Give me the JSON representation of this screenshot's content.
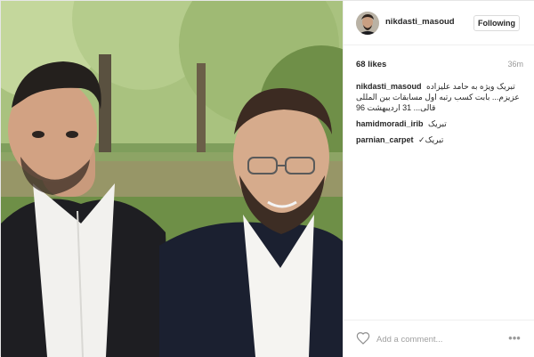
{
  "post": {
    "photo_alt": "Photo of two men",
    "header": {
      "username": "nikdasti_masoud",
      "follow_label": "Following"
    },
    "likes": "68 likes",
    "time": "36m",
    "caption": {
      "user": "nikdasti_masoud",
      "text": "تبریک ویژه به حامد علیزاده عزیزم... بابت کسب رتبه اول مسابقات بین المللی قالی... 31 اردیبهشت 96"
    },
    "comments": [
      {
        "user": "hamidmoradi_irib",
        "text": "تبریک"
      },
      {
        "user": "parnian_carpet",
        "text": "تبریک✓"
      }
    ],
    "add_comment_placeholder": "Add a comment...",
    "more_label": "•••"
  },
  "colors": {
    "link": "#262626",
    "muted": "#999999",
    "border": "#efefef"
  }
}
